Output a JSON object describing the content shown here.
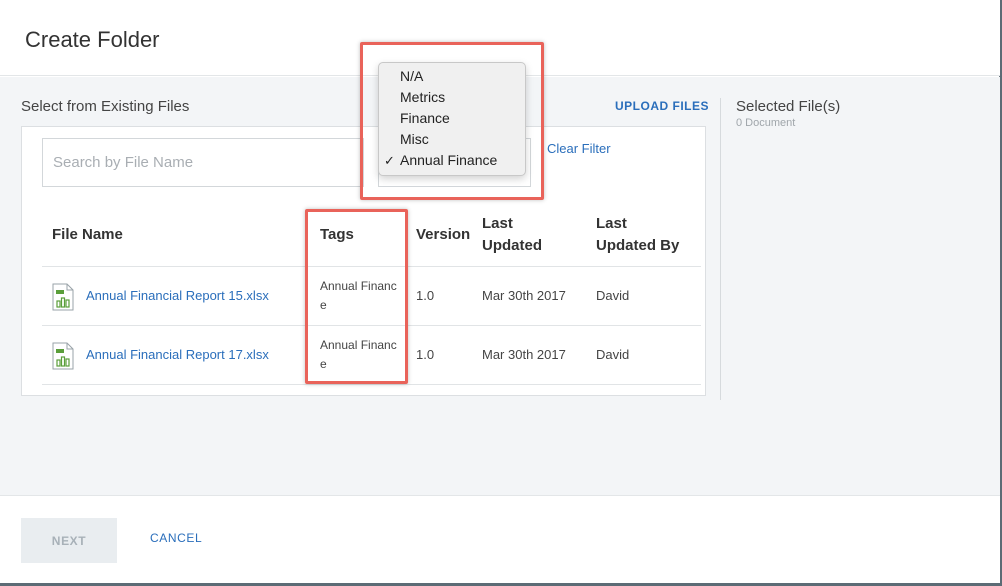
{
  "dialog": {
    "title": "Create Folder"
  },
  "left": {
    "section_label": "Select from Existing Files",
    "upload_label": "UPLOAD FILES",
    "search_placeholder": "Search by File Name",
    "clear_filter_label": "Clear Filter"
  },
  "table": {
    "headers": {
      "file_name": "File Name",
      "tags": "Tags",
      "version": "Version",
      "last_updated": [
        "Last",
        "Updated"
      ],
      "last_updated_by": [
        "Last",
        "Updated By"
      ]
    },
    "rows": [
      {
        "file_name": "Annual Financial Report 15.xlsx",
        "tags": "Annual Finance",
        "version": "1.0",
        "last_updated": "Mar 30th 2017",
        "updated_by": "David",
        "icon": "spreadsheet-icon"
      },
      {
        "file_name": "Annual Financial Report 17.xlsx",
        "tags": "Annual Finance",
        "version": "1.0",
        "last_updated": "Mar 30th 2017",
        "updated_by": "David",
        "icon": "spreadsheet-icon"
      }
    ]
  },
  "dropdown": {
    "options": [
      "N/A",
      "Metrics",
      "Finance",
      "Misc",
      "Annual Finance"
    ],
    "selected": "Annual Finance",
    "check_glyph": "✓"
  },
  "right": {
    "title": "Selected File(s)",
    "count": "0 Document"
  },
  "footer": {
    "next_label": "NEXT",
    "cancel_label": "CANCEL"
  },
  "colors": {
    "link": "#2a6ebb",
    "highlight": "#e9635a",
    "icon_green": "#5a9e3a"
  }
}
